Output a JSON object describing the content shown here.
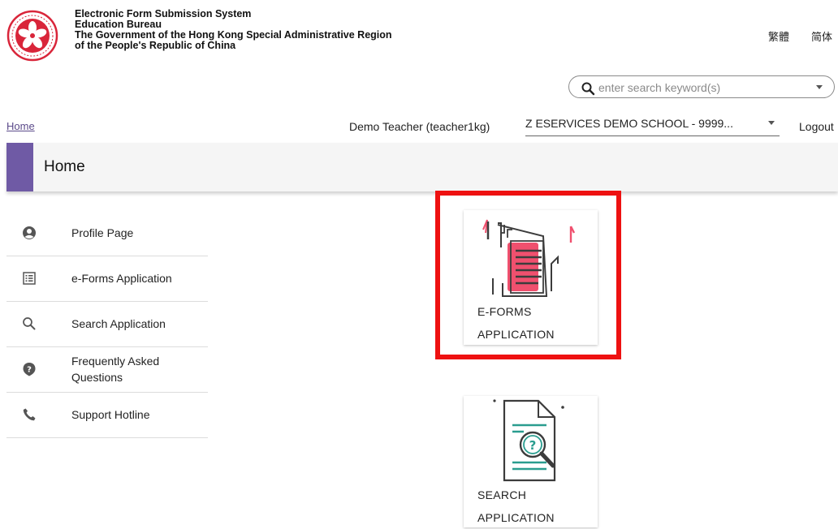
{
  "header": {
    "lines": [
      "Electronic Form Submission System",
      "Education Bureau",
      "The Government of the Hong Kong Special Administrative Region",
      "of the People's Republic of China"
    ],
    "lang_traditional": "繁體",
    "lang_simplified": "简体",
    "logo_icon": "hksar-emblem-icon"
  },
  "search": {
    "placeholder": "enter search keyword(s)",
    "value": ""
  },
  "nav": {
    "home_link": "Home",
    "user": "Demo Teacher (teacher1kg)",
    "school": "Z ESERVICES DEMO SCHOOL - 9999...",
    "logout": "Logout"
  },
  "page": {
    "title": "Home"
  },
  "sidebar": {
    "items": [
      {
        "label": "Profile Page",
        "icon": "account-circle-icon"
      },
      {
        "label": "e-Forms Application",
        "icon": "list-form-icon"
      },
      {
        "label": "Search Application",
        "icon": "search-icon"
      },
      {
        "label": "Frequently Asked Questions",
        "icon": "question-help-icon"
      },
      {
        "label": "Support Hotline",
        "icon": "phone-icon"
      }
    ]
  },
  "tiles": [
    {
      "label_line1": "E-FORMS",
      "label_line2": "APPLICATION",
      "icon": "eforms-document-icon",
      "highlighted": true
    },
    {
      "label_line1": "SEARCH",
      "label_line2": "APPLICATION",
      "icon": "search-document-icon",
      "highlighted": false
    }
  ],
  "colors": {
    "accent_purple": "#6f5aa5",
    "highlight_red": "#ee1111",
    "icon_pink": "#f0506e",
    "icon_teal": "#2a9d8f",
    "icon_dark": "#3c3c3c"
  }
}
